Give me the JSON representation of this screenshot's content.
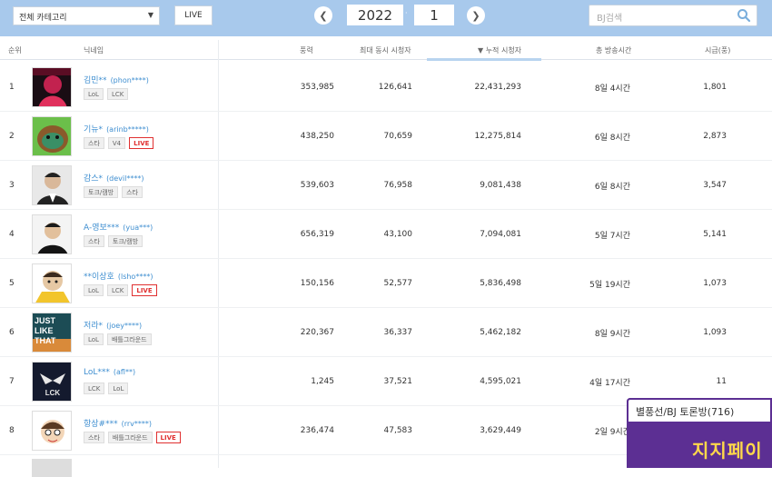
{
  "topbar": {
    "category": "전체 카테고리",
    "live_label": "LIVE",
    "year": "2022",
    "month": "1",
    "separator": "·",
    "prev_label": "❮",
    "next_label": "❯",
    "search_placeholder": "BJ검색"
  },
  "table": {
    "headers": {
      "rank": "순위",
      "nickname": "닉네임",
      "fans": "풍력",
      "max_viewers": "최대 동시 시청자",
      "cumulative_viewers": "▼ 누적 시청자",
      "total_time": "총 방송시간",
      "hourly": "시급(풍)"
    },
    "rows": [
      {
        "rank": "1",
        "name": "김민**",
        "id": "(phon****)",
        "tags": [
          "LoL",
          "LCK"
        ],
        "live": false,
        "fans": "353,985",
        "max": "126,641",
        "cum": "22,431,293",
        "time": "8일 4시간",
        "hourly": "1,801"
      },
      {
        "rank": "2",
        "name": "기뉴*",
        "id": "(arinb*****)",
        "tags": [
          "스타",
          "V4"
        ],
        "live": true,
        "fans": "438,250",
        "max": "70,659",
        "cum": "12,275,814",
        "time": "6일 8시간",
        "hourly": "2,873"
      },
      {
        "rank": "3",
        "name": "감스*",
        "id": "(devil****)",
        "tags": [
          "토크/캠방",
          "스타"
        ],
        "live": false,
        "fans": "539,603",
        "max": "76,958",
        "cum": "9,081,438",
        "time": "6일 8시간",
        "hourly": "3,547"
      },
      {
        "rank": "4",
        "name": "A-영보***",
        "id": "(yua***)",
        "tags": [
          "스타",
          "토크/캠방"
        ],
        "live": false,
        "fans": "656,319",
        "max": "43,100",
        "cum": "7,094,081",
        "time": "5일 7시간",
        "hourly": "5,141"
      },
      {
        "rank": "5",
        "name": "**이상호",
        "id": "(lsho****)",
        "tags": [
          "LoL",
          "LCK"
        ],
        "live": true,
        "fans": "150,156",
        "max": "52,577",
        "cum": "5,836,498",
        "time": "5일 19시간",
        "hourly": "1,073"
      },
      {
        "rank": "6",
        "name": "저라*",
        "id": "(joey****)",
        "tags": [
          "LoL",
          "배틀그라운드"
        ],
        "live": false,
        "fans": "220,367",
        "max": "36,337",
        "cum": "5,462,182",
        "time": "8일 9시간",
        "hourly": "1,093"
      },
      {
        "rank": "7",
        "name": "LoL***",
        "id": "(afl**)",
        "tags": [
          "LCK",
          "LoL"
        ],
        "live": false,
        "fans": "1,245",
        "max": "37,521",
        "cum": "4,595,021",
        "time": "4일 17시간",
        "hourly": "11"
      },
      {
        "rank": "8",
        "name": "항상#***",
        "id": "(rrv****)",
        "tags": [
          "스타",
          "배틀그라운드"
        ],
        "live": true,
        "fans": "236,474",
        "max": "47,583",
        "cum": "3,629,449",
        "time": "2일 9시간",
        "hourly": ""
      }
    ],
    "live_badge": "LIVE"
  },
  "popup": {
    "title": "별풍선/BJ 토론방(716)",
    "banner": "지지페이"
  },
  "avatar_art": {
    "row6_text": "JUST LIKE THAT",
    "row7_text": "LCK"
  },
  "colors": {
    "topbar": "#a8c9ec",
    "link": "#3e8ed0",
    "live_red": "#e03030",
    "popup_purple": "#5c2f93",
    "banner_yellow": "#ffd84a"
  }
}
